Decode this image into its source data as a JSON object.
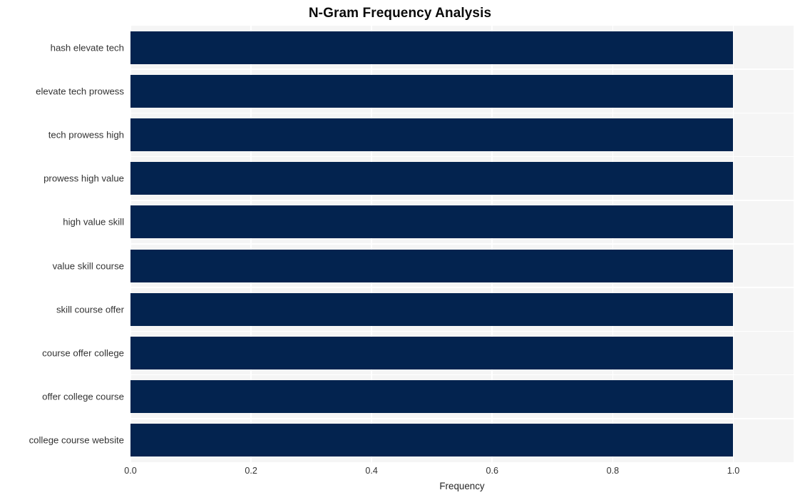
{
  "chart_data": {
    "type": "bar",
    "orientation": "horizontal",
    "title": "N-Gram Frequency Analysis",
    "xlabel": "Frequency",
    "ylabel": "",
    "categories": [
      "hash elevate tech",
      "elevate tech prowess",
      "tech prowess high",
      "prowess high value",
      "high value skill",
      "value skill course",
      "skill course offer",
      "course offer college",
      "offer college course",
      "college course website"
    ],
    "values": [
      1.0,
      1.0,
      1.0,
      1.0,
      1.0,
      1.0,
      1.0,
      1.0,
      1.0,
      1.0
    ],
    "xlim": [
      0.0,
      1.1
    ],
    "xticks": [
      0.0,
      0.2,
      0.4,
      0.6,
      0.8,
      1.0
    ],
    "xtick_labels": [
      "0.0",
      "0.2",
      "0.4",
      "0.6",
      "0.8",
      "1.0"
    ],
    "grid": true,
    "grid_color": "#ffffff",
    "legend": null,
    "bar_color": "#03234f",
    "plot_background": "#f5f5f5",
    "figure_background": "#ffffff"
  }
}
